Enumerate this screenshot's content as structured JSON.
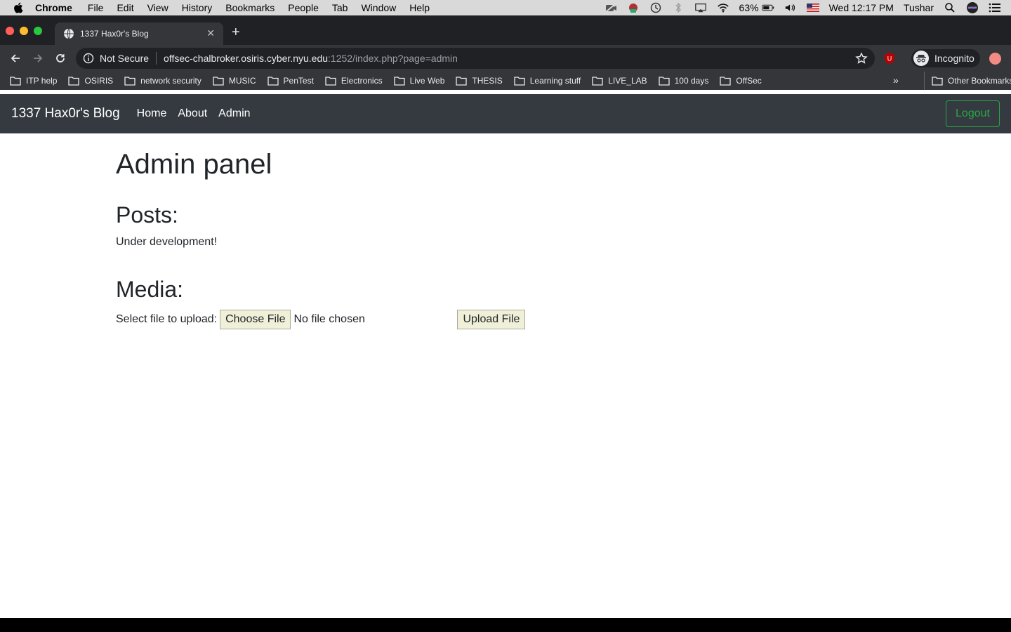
{
  "menubar": {
    "app": "Chrome",
    "items": [
      "File",
      "Edit",
      "View",
      "History",
      "Bookmarks",
      "People",
      "Tab",
      "Window",
      "Help"
    ],
    "battery": "63%",
    "clock": "Wed 12:17 PM",
    "user": "Tushar"
  },
  "tab": {
    "title": "1337 Hax0r's Blog"
  },
  "omnibox": {
    "security": "Not Secure",
    "host": "offsec-chalbroker.osiris.cyber.nyu.edu",
    "path": ":1252/index.php?page=admin"
  },
  "incognito": "Incognito",
  "bookmarks": {
    "items": [
      "ITP help",
      "OSIRIS",
      "network security",
      "MUSIC",
      "PenTest",
      "Electronics",
      "Live Web",
      "THESIS",
      "Learning stuff",
      "LIVE_LAB",
      "100 days",
      "OffSec"
    ],
    "more": "»",
    "other": "Other Bookmarks"
  },
  "site": {
    "brand": "1337 Hax0r's Blog",
    "nav": [
      "Home",
      "About",
      "Admin"
    ],
    "logout": "Logout"
  },
  "main": {
    "title": "Admin panel",
    "posts_heading": "Posts:",
    "posts_text": "Under development!",
    "media_heading": "Media:",
    "upload_label": "Select file to upload:",
    "choose_button": "Choose File",
    "file_status": "No file chosen",
    "upload_button": "Upload File"
  },
  "colors": {
    "navbar": "#343a40",
    "logout": "#28a745",
    "chrome_dark": "#202124"
  }
}
